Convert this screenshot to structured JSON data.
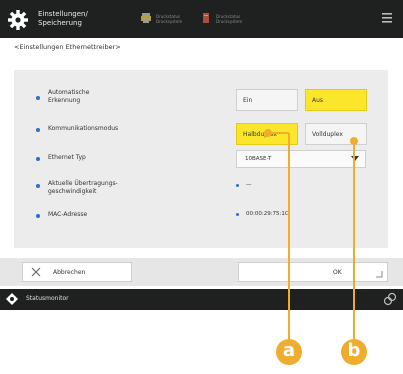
{
  "header": {
    "title_line1": "Einstellungen/",
    "title_line2": "Speicherung",
    "status_items": [
      {
        "icon": "printer-icon",
        "line1": "Druckstatus",
        "line2": "Drucksystem"
      },
      {
        "icon": "toner-icon",
        "line1": "Druckstatus",
        "line2": "Drucksystem"
      }
    ],
    "menu_icon": "menu-icon"
  },
  "page": {
    "subtitle": "<Einstellungen Ethernettreiber>"
  },
  "rows": [
    {
      "label_line1": "Automatische",
      "label_line2": "Erkennung"
    },
    {
      "label_line1": "Kommunikationsmodus",
      "label_line2": ""
    },
    {
      "label_line1": "Ethernet Typ",
      "label_line2": ""
    },
    {
      "label_line1": "Aktuelle Übertragungs-",
      "label_line2": "geschwindigkeit"
    },
    {
      "label_line1": "MAC-Adresse",
      "label_line2": ""
    }
  ],
  "auto_detect": {
    "on_label": "Ein",
    "off_label": "Aus",
    "selected": "off"
  },
  "comm_mode": {
    "half_label": "Halbduplex",
    "full_label": "Vollduplex",
    "selected": "half"
  },
  "ethernet_type": {
    "value": "10BASE-T"
  },
  "current_speed": {
    "value": "—"
  },
  "mac_address": {
    "value": "00:00:29:75:1C:"
  },
  "footer": {
    "cancel_label": "Abbrechen",
    "ok_label": "OK"
  },
  "statusbar": {
    "label": "Statusmonitor"
  },
  "callouts": {
    "a": "a",
    "b": "b",
    "color": "#f0ad2d"
  },
  "colors": {
    "accent_selected": "#fbe62c",
    "bar": "#1f2020",
    "bullet": "#2a6fd1"
  }
}
